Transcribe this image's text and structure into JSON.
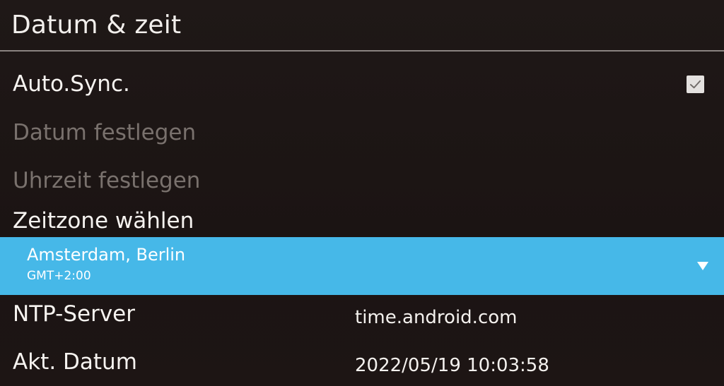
{
  "header": {
    "title": "Datum & zeit"
  },
  "settings": {
    "auto_sync": {
      "label": "Auto.Sync.",
      "checked": true
    },
    "set_date": {
      "label": "Datum festlegen",
      "enabled": false
    },
    "set_time": {
      "label": "Uhrzeit festlegen",
      "enabled": false
    },
    "timezone": {
      "label": "Zeitzone wählen",
      "selected_name": "Amsterdam, Berlin",
      "selected_offset": "GMT+2:00"
    },
    "ntp_server": {
      "label": "NTP-Server",
      "value": "time.android.com"
    },
    "current_date": {
      "label": "Akt. Datum",
      "value": "2022/05/19 10:03:58"
    }
  },
  "colors": {
    "background": "#1d1615",
    "highlight": "#46b8e8",
    "disabled_text": "#79716d"
  },
  "icons": {
    "checkbox": "checkmark-icon",
    "dropdown": "triangle-down-icon"
  }
}
